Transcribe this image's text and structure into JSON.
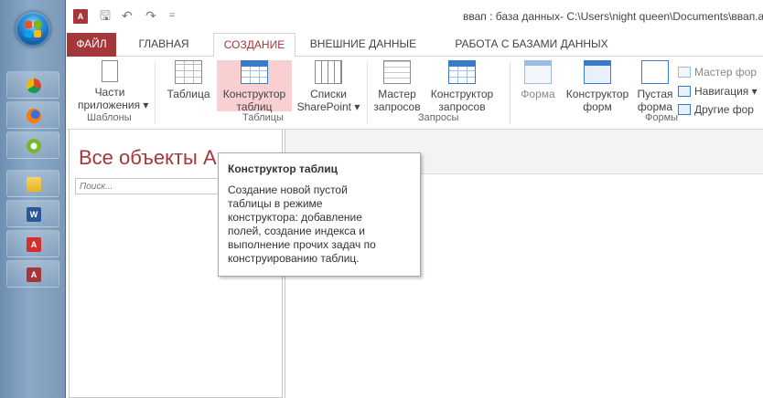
{
  "window": {
    "title": "ввап : база данных- C:\\Users\\night queen\\Documents\\ввап.acc",
    "app_logo": "A",
    "qat": {
      "save": "🖫",
      "undo": "↶",
      "redo": "↷",
      "customize": "="
    }
  },
  "tabs": [
    {
      "label": "ФАЙЛ"
    },
    {
      "label": "ГЛАВНАЯ"
    },
    {
      "label": "СОЗДАНИЕ"
    },
    {
      "label": "ВНЕШНИЕ ДАННЫЕ"
    },
    {
      "label": "РАБОТА С БАЗАМИ ДАННЫХ"
    }
  ],
  "active_tab": "СОЗДАНИЕ",
  "ribbon": {
    "templates": {
      "group": "Шаблоны",
      "app_parts": {
        "line1": "Части",
        "line2": "приложения ▾"
      }
    },
    "tables": {
      "group": "Таблицы",
      "table": {
        "line1": "Таблица"
      },
      "table_design": {
        "line1": "Конструктор",
        "line2": "таблиц"
      },
      "sharepoint": {
        "line1": "Списки",
        "line2": "SharePoint ▾"
      }
    },
    "queries": {
      "group": "Запросы",
      "query_wizard": {
        "line1": "Мастер",
        "line2": "запросов"
      },
      "query_design": {
        "line1": "Конструктор",
        "line2": "запросов"
      }
    },
    "forms": {
      "group": "Формы",
      "form": {
        "line1": "Форма"
      },
      "form_design": {
        "line1": "Конструктор",
        "line2": "форм"
      },
      "blank_form": {
        "line1": "Пустая",
        "line2": "форма"
      },
      "form_wizard": "Мастер фор",
      "navigation": "Навигация ▾",
      "more_forms": "Другие фор"
    }
  },
  "nav_pane": {
    "title": "Все объекты A",
    "search_placeholder": "Поиск..."
  },
  "tooltip": {
    "title": "Конструктор таблиц",
    "lines": [
      "Создание новой пустой",
      "таблицы в режиме",
      "конструктора: добавление",
      "полей, создание индекса и",
      "выполнение прочих задач по",
      "конструированию таблиц."
    ]
  },
  "taskbar": {
    "icons": [
      "chrome-icon",
      "firefox-icon",
      "utorrent-icon",
      "explorer-icon",
      "word-icon",
      "acrobat-icon",
      "access-icon"
    ],
    "labels": {
      "word": "W",
      "acrobat": "A",
      "access": "A"
    }
  },
  "colors": {
    "accent": "#a4373a",
    "highlight": "#f8d0d1",
    "taskbar": "#7b99b8"
  }
}
